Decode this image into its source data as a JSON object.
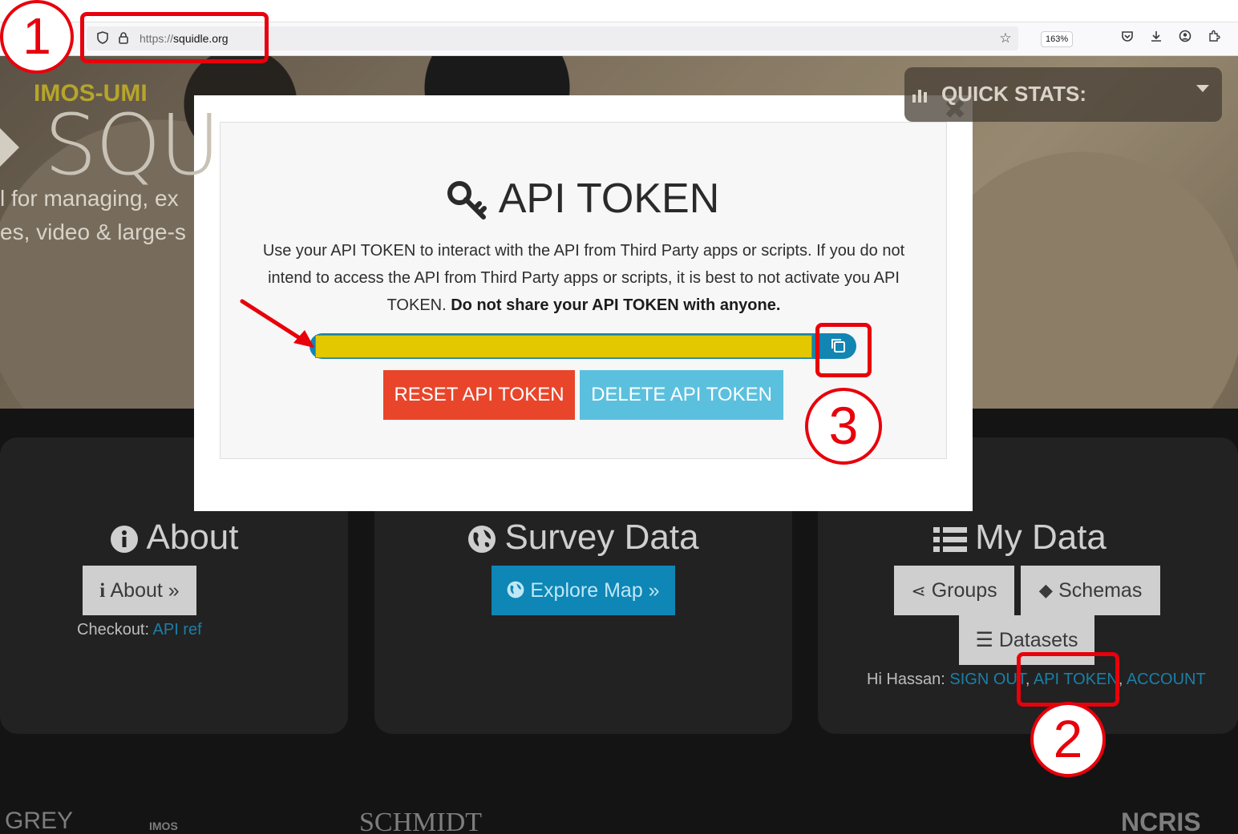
{
  "browser": {
    "url_scheme": "https://",
    "url_host": "squidle.org",
    "zoom": "163%"
  },
  "hero": {
    "brand": "IMOS-UMI",
    "logo_text": "SQU",
    "tagline_1": "l for managing, ex",
    "tagline_2": "es, video & large-s",
    "quick_stats": "QUICK STATS:"
  },
  "modal": {
    "title": "API TOKEN",
    "desc_line_1": "Use your API TOKEN to interact with the API from Third Party apps or scripts. If you do not",
    "desc_line_2": "intend to access the API from Third Party apps or scripts, it is best to not activate you API",
    "desc_line_3_plain": "TOKEN.",
    "desc_line_3_bold": "Do not share your API TOKEN with anyone.",
    "reset_label": "RESET API TOKEN",
    "delete_label": "DELETE API TOKEN",
    "close_glyph": "✖"
  },
  "about": {
    "title": "About",
    "button": "About »",
    "checkout_label": "Checkout:",
    "checkout_link": "API ref"
  },
  "survey": {
    "title": "Survey Data",
    "button": "Explore Map »"
  },
  "mydata": {
    "title": "My Data",
    "groups": "Groups",
    "schemas": "Schemas",
    "datasets": "Datasets",
    "greeting": "Hi Hassan:",
    "sign_out": "SIGN OUT",
    "api_token": "API TOKEN",
    "separator": ",",
    "account": "ACCOUNT"
  },
  "partners": {
    "grey": "GREY",
    "imos": "IMOS",
    "schmidt": "SCHMIDT",
    "ncris": "NCRIS"
  },
  "annotations": {
    "step_1": "1",
    "step_2": "2",
    "step_3": "3",
    "color": "#e8000b"
  }
}
